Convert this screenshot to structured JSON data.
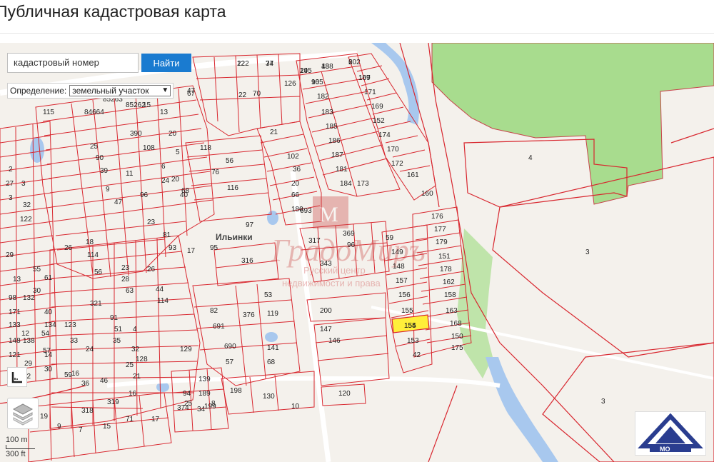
{
  "header": {
    "title": "Публичная кадастровая карта"
  },
  "search": {
    "placeholder": "кадастровый номер",
    "button_label": "Найти"
  },
  "definition": {
    "label": "Определение:",
    "selected": "земельный участок"
  },
  "map": {
    "place_label": "Ильинки",
    "watermark": {
      "line1": "Русский центр",
      "line2": "недвижимости и права"
    },
    "highlighted_plot": "155",
    "large_area_labels": [
      "4",
      "3",
      "3"
    ],
    "plot_labels": [
      "22",
      "74",
      "145",
      "188",
      "202",
      "167",
      "165",
      "171",
      "182",
      "169",
      "183",
      "152",
      "185",
      "174",
      "186",
      "170",
      "187",
      "172",
      "181",
      "161",
      "184",
      "160",
      "173",
      "176",
      "177",
      "179",
      "151",
      "178",
      "162",
      "158",
      "163",
      "168",
      "150",
      "175",
      "59",
      "149",
      "148",
      "157",
      "156",
      "155",
      "154",
      "153",
      "42",
      "47",
      "67",
      "22",
      "70",
      "126",
      "115",
      "84664",
      "85263",
      "85262",
      "15",
      "13",
      "20",
      "390",
      "108",
      "25",
      "90",
      "39",
      "11",
      "9",
      "47",
      "96",
      "6",
      "24",
      "5",
      "118",
      "76",
      "20",
      "68",
      "40",
      "116",
      "56",
      "102",
      "36",
      "20",
      "66",
      "693",
      "180",
      "21",
      "97",
      "23",
      "81",
      "93",
      "17",
      "95",
      "316",
      "317",
      "369",
      "96",
      "343",
      "200",
      "53",
      "119",
      "376",
      "82",
      "691",
      "690",
      "147",
      "146",
      "141",
      "68",
      "57",
      "94",
      "25",
      "189",
      "199",
      "198",
      "130",
      "120",
      "10",
      "374",
      "34",
      "8",
      "129",
      "139",
      "318",
      "319",
      "16",
      "19",
      "9",
      "7",
      "15",
      "71",
      "17",
      "18",
      "114",
      "98",
      "132",
      "171",
      "133",
      "12",
      "54",
      "29",
      "61",
      "13",
      "40",
      "134",
      "148",
      "138",
      "121",
      "29",
      "123",
      "12",
      "57",
      "2",
      "27",
      "3",
      "3",
      "32",
      "122",
      "14",
      "30",
      "26",
      "26",
      "23",
      "28",
      "63",
      "44",
      "114",
      "321",
      "91",
      "51",
      "4",
      "35",
      "32",
      "128",
      "24",
      "25",
      "21",
      "16",
      "36",
      "46",
      "59",
      "33",
      "30",
      "55",
      "56",
      "122",
      "37",
      "29",
      "43",
      "6",
      "109",
      "90"
    ]
  },
  "scale": {
    "metric": "100 m",
    "imperial": "300 ft"
  },
  "colors": {
    "parcel_stroke": "#d8262e",
    "highlight_fill": "#ffef3a",
    "forest": "#a8dc8e",
    "water": "#a8c8ee",
    "button": "#1a7bd0"
  },
  "icons": {
    "ruler": "ruler-icon",
    "layers": "layers-icon",
    "logo": "agency-logo"
  }
}
